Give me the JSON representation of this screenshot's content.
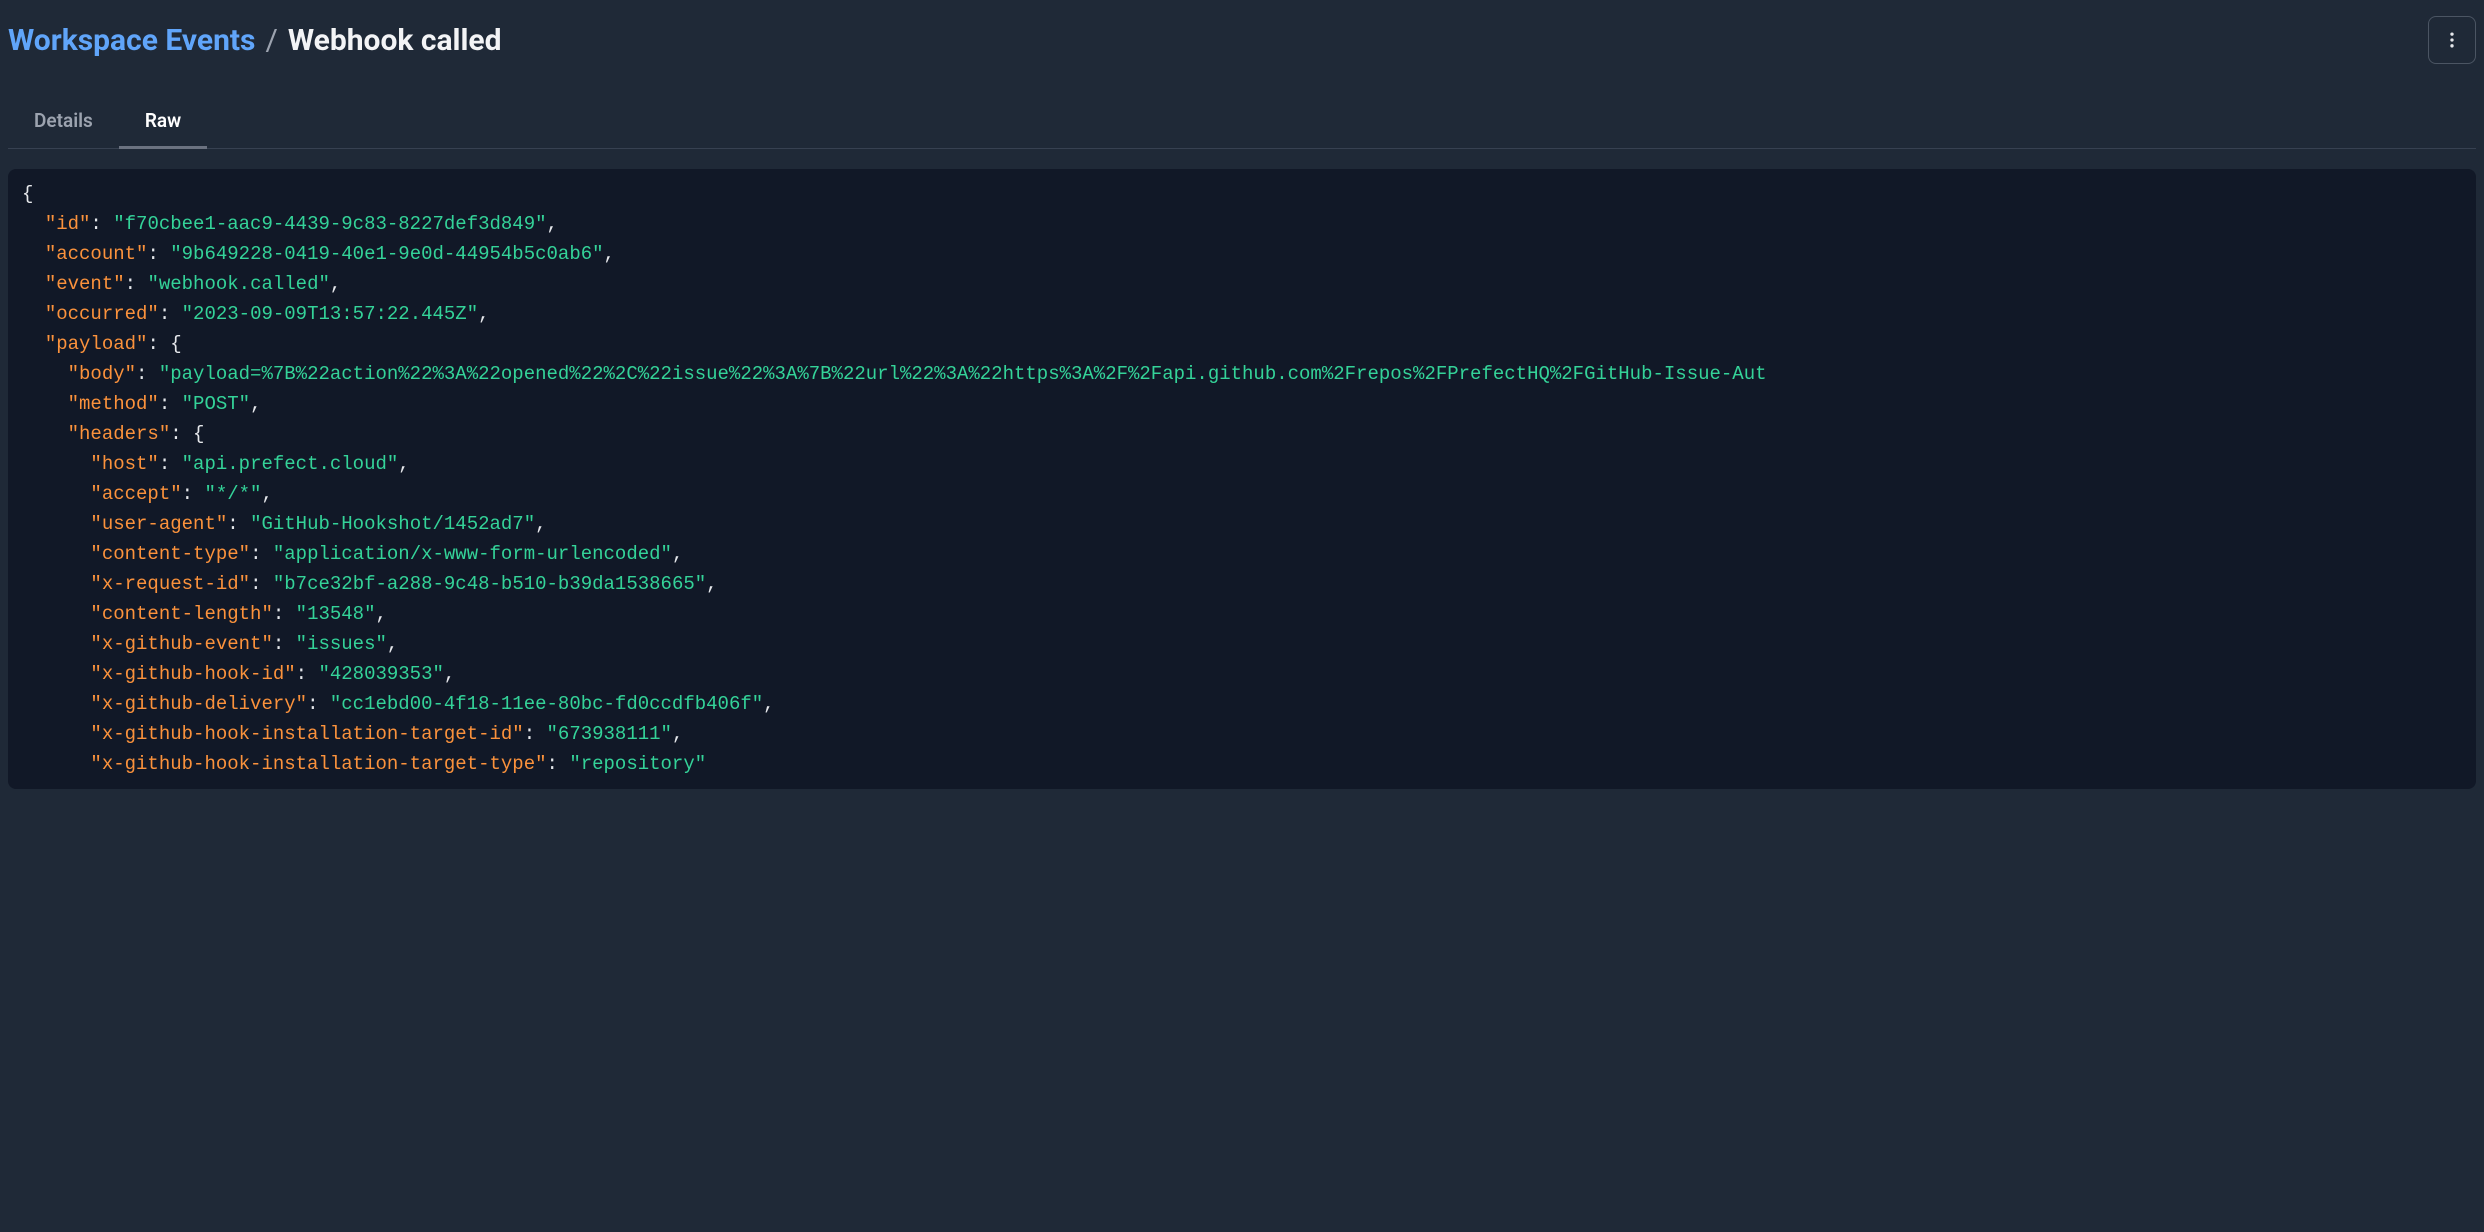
{
  "breadcrumb": {
    "link": "Workspace Events",
    "separator": "/",
    "current": "Webhook called"
  },
  "tabs": {
    "details": "Details",
    "raw": "Raw"
  },
  "json": {
    "id_key": "\"id\"",
    "id_val": "\"f70cbee1-aac9-4439-9c83-8227def3d849\"",
    "account_key": "\"account\"",
    "account_val": "\"9b649228-0419-40e1-9e0d-44954b5c0ab6\"",
    "event_key": "\"event\"",
    "event_val": "\"webhook.called\"",
    "occurred_key": "\"occurred\"",
    "occurred_val": "\"2023-09-09T13:57:22.445Z\"",
    "payload_key": "\"payload\"",
    "body_key": "\"body\"",
    "body_val": "\"payload=%7B%22action%22%3A%22opened%22%2C%22issue%22%3A%7B%22url%22%3A%22https%3A%2F%2Fapi.github.com%2Frepos%2FPrefectHQ%2FGitHub-Issue-Aut",
    "method_key": "\"method\"",
    "method_val": "\"POST\"",
    "headers_key": "\"headers\"",
    "host_key": "\"host\"",
    "host_val": "\"api.prefect.cloud\"",
    "accept_key": "\"accept\"",
    "accept_val": "\"*/*\"",
    "ua_key": "\"user-agent\"",
    "ua_val": "\"GitHub-Hookshot/1452ad7\"",
    "ct_key": "\"content-type\"",
    "ct_val": "\"application/x-www-form-urlencoded\"",
    "xreq_key": "\"x-request-id\"",
    "xreq_val": "\"b7ce32bf-a288-9c48-b510-b39da1538665\"",
    "cl_key": "\"content-length\"",
    "cl_val": "\"13548\"",
    "xge_key": "\"x-github-event\"",
    "xge_val": "\"issues\"",
    "xghi_key": "\"x-github-hook-id\"",
    "xghi_val": "\"428039353\"",
    "xgd_key": "\"x-github-delivery\"",
    "xgd_val": "\"cc1ebd00-4f18-11ee-80bc-fd0ccdfb406f\"",
    "xgiti_key": "\"x-github-hook-installation-target-id\"",
    "xgiti_val": "\"673938111\"",
    "xgitt_key": "\"x-github-hook-installation-target-type\"",
    "xgitt_val": "\"repository\""
  }
}
